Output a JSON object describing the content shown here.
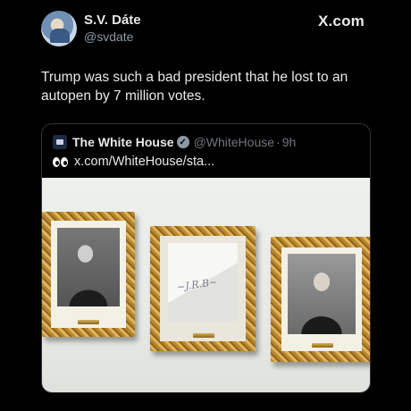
{
  "author": {
    "display_name": "S.V. Dáte",
    "handle": "@svdate",
    "avatar_icon": "user-avatar"
  },
  "brand": "X.com",
  "tweet": {
    "text": "Trump was such a bad president that he lost to an autopen by 7 million votes."
  },
  "quoted_tweet": {
    "display_name": "The White House",
    "handle": "@WhiteHouse",
    "separator": "·",
    "time": "9h",
    "logo_icon": "white-house-logo",
    "verified_icon": "verified-badge-icon",
    "eyes_icon": "eyes-emoji-icon",
    "text": "x.com/WhiteHouse/sta..."
  },
  "photo": {
    "frames": [
      "portrait-left",
      "autopen-signature",
      "portrait-right"
    ]
  },
  "colors": {
    "background": "#000000",
    "text": "#e7e9ea",
    "secondary_text": "#8b98a5",
    "border": "#2f3336"
  }
}
